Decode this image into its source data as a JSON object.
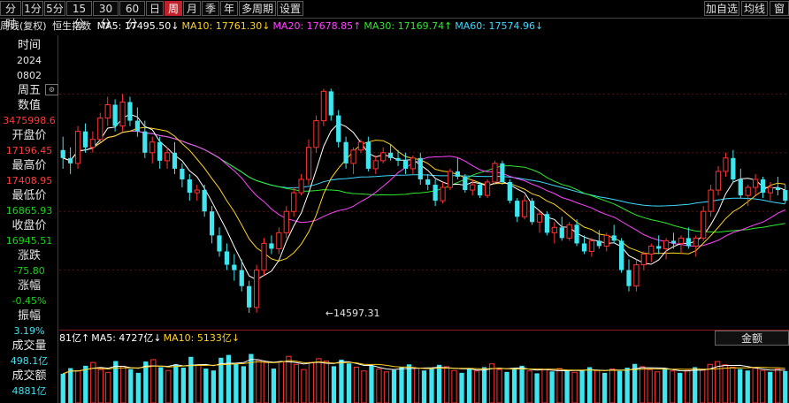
{
  "toolbar": {
    "left_items": [
      {
        "label": "分时",
        "active": false
      },
      {
        "label": "1分",
        "active": false
      },
      {
        "label": "5分",
        "active": false
      },
      {
        "label": "15分",
        "active": false
      },
      {
        "label": "30分",
        "active": false
      },
      {
        "label": "60分",
        "active": false
      },
      {
        "label": "日",
        "active": false
      },
      {
        "label": "周",
        "active": true
      },
      {
        "label": "月",
        "active": false
      },
      {
        "label": "季",
        "active": false
      },
      {
        "label": "年",
        "active": false
      },
      {
        "label": "多周期",
        "active": false
      },
      {
        "label": "设置",
        "active": false
      }
    ],
    "right_items": [
      {
        "label": "加自选"
      },
      {
        "label": "均线"
      },
      {
        "label": "窗"
      }
    ]
  },
  "indicator_bar": {
    "period_mode": "周线(复权)",
    "index_name": "恒生指数",
    "ma": [
      {
        "text": "MA5: 17495.50↓",
        "color": "#ffffff"
      },
      {
        "text": "MA10: 17761.30↓",
        "color": "#ffd21f"
      },
      {
        "text": "MA20: 17678.85↑",
        "color": "#ff44ff"
      },
      {
        "text": "MA30: 17169.74↑",
        "color": "#2ee82e"
      },
      {
        "text": "MA60: 17574.96↓",
        "color": "#3fd8ff"
      }
    ]
  },
  "sidebar": {
    "time_label": "时间",
    "year": "2024",
    "date": "0802",
    "weekday": "周五",
    "value_label": "数值",
    "value": "3475998.6",
    "open_label": "开盘价",
    "open": "17196.45",
    "high_label": "最高价",
    "high": "17408.95",
    "low_label": "最低价",
    "low": "16865.93",
    "close_label": "收盘价",
    "close": "16945.51",
    "change_label": "涨跌",
    "change": "-75.80",
    "pct_label": "涨幅",
    "pct": "-0.45%",
    "amplitude_label": "振幅",
    "amplitude": "3.19%",
    "volume_label": "成交量",
    "volume": "498.1亿",
    "turnover_label": "成交额",
    "turnover": "4881亿"
  },
  "volume_header": {
    "items": [
      {
        "text": "81亿↑",
        "color": "#ffffff"
      },
      {
        "text": "MA5: 4727亿↓",
        "color": "#ffffff"
      },
      {
        "text": "MA10: 5133亿↓",
        "color": "#ffd21f"
      }
    ],
    "metric": "金额"
  },
  "chart_data": {
    "type": "candlestick",
    "period": "weekly",
    "ylim": [
      14300,
      19800
    ],
    "annotation": {
      "text": "←14597.31",
      "value": 14597.31,
      "index": 35
    },
    "colors": {
      "up": "#ff3232",
      "down": "#3fe6f0",
      "ma5": "#ffffff",
      "ma10": "#ffd21f",
      "ma20": "#ff44ff",
      "ma30": "#2ee82e",
      "ma60": "#3fd8ff"
    },
    "candles": [
      [
        17650,
        17900,
        17300,
        17500
      ],
      [
        17500,
        17700,
        17200,
        17400
      ],
      [
        17400,
        18100,
        17300,
        18000
      ],
      [
        18000,
        18150,
        17600,
        17700
      ],
      [
        17700,
        18000,
        17600,
        17850
      ],
      [
        17850,
        18350,
        17800,
        18250
      ],
      [
        18250,
        18650,
        18100,
        18500
      ],
      [
        18500,
        18600,
        18000,
        18100
      ],
      [
        18100,
        18700,
        18000,
        18550
      ],
      [
        18550,
        18650,
        18100,
        18200
      ],
      [
        18200,
        18450,
        17900,
        18000
      ],
      [
        18000,
        18200,
        17500,
        17600
      ],
      [
        17600,
        17900,
        17400,
        17800
      ],
      [
        17800,
        17900,
        17300,
        17450
      ],
      [
        17450,
        17700,
        17300,
        17600
      ],
      [
        17600,
        17800,
        17200,
        17300
      ],
      [
        17300,
        17400,
        16950,
        17100
      ],
      [
        17100,
        17200,
        16700,
        16850
      ],
      [
        16850,
        17000,
        16700,
        16900
      ],
      [
        16900,
        17000,
        16400,
        16500
      ],
      [
        16500,
        16600,
        15900,
        16050
      ],
      [
        16050,
        16200,
        15650,
        15750
      ],
      [
        15750,
        15900,
        15400,
        15500
      ],
      [
        15500,
        15700,
        15200,
        15400
      ],
      [
        15400,
        15600,
        15000,
        15100
      ],
      [
        15100,
        15200,
        14600,
        14700
      ],
      [
        14700,
        15500,
        14600,
        15400
      ],
      [
        15400,
        16000,
        15300,
        15900
      ],
      [
        15900,
        16050,
        15700,
        15800
      ],
      [
        15800,
        16200,
        15700,
        16100
      ],
      [
        16100,
        16600,
        16000,
        16500
      ],
      [
        16500,
        16950,
        16400,
        16850
      ],
      [
        16850,
        17200,
        16800,
        17100
      ],
      [
        17100,
        17850,
        17000,
        17700
      ],
      [
        17700,
        18300,
        17600,
        18200
      ],
      [
        18200,
        18800,
        18100,
        18750
      ],
      [
        18750,
        18800,
        18200,
        18300
      ],
      [
        18300,
        18400,
        17700,
        17800
      ],
      [
        17800,
        17900,
        17300,
        17400
      ],
      [
        17400,
        17700,
        17200,
        17650
      ],
      [
        17650,
        17850,
        17600,
        17800
      ],
      [
        17800,
        17900,
        17250,
        17300
      ],
      [
        17300,
        17550,
        17200,
        17450
      ],
      [
        17450,
        17700,
        17400,
        17600
      ],
      [
        17600,
        17750,
        17450,
        17500
      ],
      [
        17500,
        17650,
        17350,
        17450
      ],
      [
        17450,
        17600,
        17200,
        17300
      ],
      [
        17300,
        17550,
        17200,
        17500
      ],
      [
        17500,
        17600,
        17000,
        17100
      ],
      [
        17100,
        17200,
        16900,
        17000
      ],
      [
        17000,
        17100,
        16600,
        16700
      ],
      [
        16700,
        17050,
        16650,
        16950
      ],
      [
        16950,
        17300,
        16900,
        17250
      ],
      [
        17250,
        17500,
        17100,
        17150
      ],
      [
        17150,
        17200,
        16850,
        16900
      ],
      [
        16900,
        17100,
        16800,
        17000
      ],
      [
        17000,
        17050,
        16750,
        16800
      ],
      [
        16800,
        17100,
        16750,
        17050
      ],
      [
        17050,
        17450,
        17000,
        17400
      ],
      [
        17400,
        17450,
        17000,
        17050
      ],
      [
        17050,
        17100,
        16650,
        16700
      ],
      [
        16700,
        16750,
        16300,
        16400
      ],
      [
        16400,
        16800,
        16350,
        16700
      ],
      [
        16700,
        16750,
        16250,
        16300
      ],
      [
        16300,
        16500,
        16100,
        16450
      ],
      [
        16450,
        16500,
        16050,
        16100
      ],
      [
        16100,
        16300,
        15900,
        16200
      ],
      [
        16200,
        16400,
        15950,
        16000
      ],
      [
        16000,
        16300,
        15950,
        16250
      ],
      [
        16250,
        16350,
        15850,
        15900
      ],
      [
        15900,
        16050,
        15700,
        15750
      ],
      [
        15750,
        16000,
        15650,
        15950
      ],
      [
        15950,
        16150,
        15800,
        15850
      ],
      [
        15850,
        16100,
        15750,
        16050
      ],
      [
        16050,
        16250,
        15900,
        15950
      ],
      [
        15950,
        16000,
        15350,
        15400
      ],
      [
        15400,
        15600,
        15000,
        15100
      ],
      [
        15100,
        15600,
        15000,
        15500
      ],
      [
        15500,
        15750,
        15400,
        15700
      ],
      [
        15700,
        15900,
        15550,
        15850
      ],
      [
        15850,
        16050,
        15700,
        15800
      ],
      [
        15800,
        16000,
        15600,
        15950
      ],
      [
        15950,
        16100,
        15800,
        15900
      ],
      [
        15900,
        16050,
        15700,
        16000
      ],
      [
        16000,
        16200,
        15800,
        15850
      ],
      [
        15850,
        16050,
        15650,
        16000
      ],
      [
        16000,
        16600,
        15950,
        16500
      ],
      [
        16500,
        17000,
        16400,
        16900
      ],
      [
        16900,
        17350,
        16800,
        17250
      ],
      [
        17250,
        17600,
        17150,
        17500
      ],
      [
        17500,
        17650,
        17050,
        17100
      ],
      [
        17100,
        17300,
        16750,
        16800
      ],
      [
        16800,
        17000,
        16600,
        16950
      ],
      [
        16950,
        17200,
        16800,
        17100
      ],
      [
        17100,
        17150,
        16750,
        16850
      ],
      [
        16850,
        17050,
        16700,
        16950
      ],
      [
        16950,
        17150,
        16800,
        16900
      ],
      [
        16900,
        17000,
        16650,
        16700
      ]
    ],
    "volume": {
      "ymax": 12000,
      "values": [
        6200,
        7400,
        6800,
        7900,
        8600,
        7100,
        6500,
        8900,
        7800,
        7200,
        6400,
        8800,
        9200,
        7600,
        6900,
        8200,
        7500,
        9800,
        8100,
        7300,
        6900,
        9600,
        10200,
        8300,
        7800,
        10400,
        9100,
        8600,
        7300,
        8800,
        9900,
        8200,
        7100,
        8600,
        9400,
        8900,
        7800,
        9200,
        8400,
        7600,
        6800,
        7900,
        7200,
        6600,
        7000,
        7600,
        8200,
        7400,
        6900,
        7300,
        8100,
        7700,
        6900,
        6400,
        7200,
        6800,
        7600,
        8300,
        7100,
        6600,
        7400,
        7900,
        6800,
        6300,
        7100,
        6700,
        7300,
        6900,
        6500,
        7000,
        7600,
        6900,
        6400,
        7200,
        6800,
        7500,
        8300,
        7700,
        7100,
        6600,
        7300,
        6800,
        6400,
        6900,
        7600,
        7100,
        8200,
        8800,
        8100,
        7600,
        7200,
        6900,
        7400,
        6900,
        6600,
        7200,
        6800
      ]
    }
  }
}
